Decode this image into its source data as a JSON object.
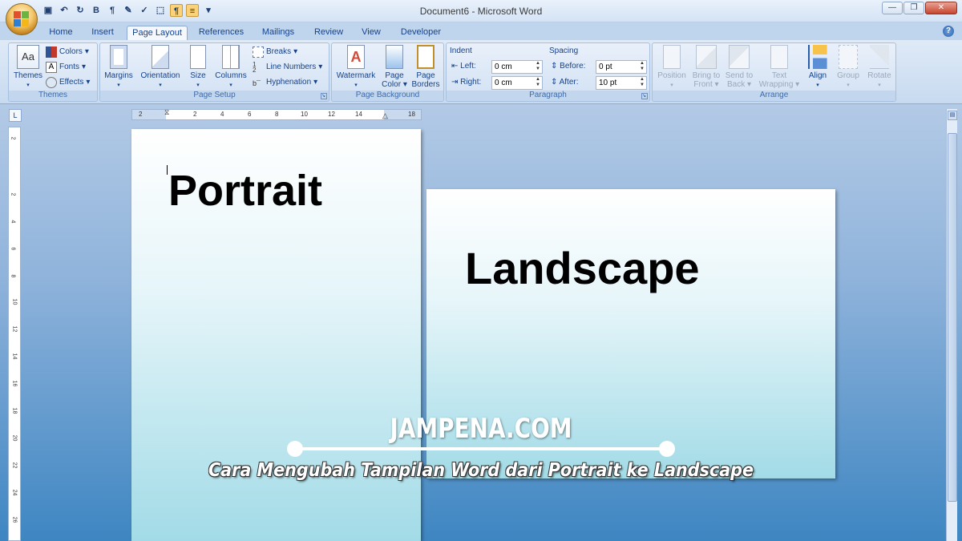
{
  "window": {
    "title": "Document6 - Microsoft Word"
  },
  "quick_access": [
    "save-icon",
    "undo-icon",
    "redo-icon",
    "bold-icon",
    "pilcrow-icon",
    "highlighter-icon",
    "spelling-icon",
    "selection-icon",
    "ltr-icon",
    "align-icon",
    "customize-icon"
  ],
  "tabs": [
    "Home",
    "Insert",
    "Page Layout",
    "References",
    "Mailings",
    "Review",
    "View",
    "Developer"
  ],
  "active_tab": "Page Layout",
  "ribbon": {
    "themes": {
      "label": "Themes",
      "themes_btn": "Themes",
      "colors": "Colors",
      "fonts": "Fonts",
      "effects": "Effects"
    },
    "page_setup": {
      "label": "Page Setup",
      "margins": "Margins",
      "orientation": "Orientation",
      "size": "Size",
      "columns": "Columns",
      "breaks": "Breaks",
      "line_numbers": "Line Numbers",
      "hyphenation": "Hyphenation"
    },
    "page_background": {
      "label": "Page Background",
      "watermark": "Watermark",
      "page_color_1": "Page",
      "page_color_2": "Color",
      "page_borders_1": "Page",
      "page_borders_2": "Borders"
    },
    "paragraph": {
      "label": "Paragraph",
      "indent": "Indent",
      "left_label": "Left:",
      "left_value": "0 cm",
      "right_label": "Right:",
      "right_value": "0 cm",
      "spacing": "Spacing",
      "before_label": "Before:",
      "before_value": "0 pt",
      "after_label": "After:",
      "after_value": "10 pt"
    },
    "arrange": {
      "label": "Arrange",
      "position": "Position",
      "bring_1": "Bring to",
      "bring_2": "Front",
      "send_1": "Send to",
      "send_2": "Back",
      "text_1": "Text",
      "text_2": "Wrapping",
      "align": "Align",
      "group": "Group",
      "rotate": "Rotate"
    }
  },
  "ruler": {
    "h_ticks": [
      "2",
      "2",
      "4",
      "6",
      "8",
      "10",
      "12",
      "14",
      "18"
    ],
    "v_ticks": [
      "2",
      "2",
      "4",
      "6",
      "8",
      "10",
      "12",
      "14",
      "16",
      "18",
      "20",
      "22",
      "24",
      "26"
    ],
    "tab_selector": "L"
  },
  "document": {
    "portrait_text": "Portrait",
    "landscape_text": "Landscape"
  },
  "overlay": {
    "brand": "JAMPENA.COM",
    "tagline": "Cara Mengubah Tampilan Word dari Portrait ke Landscape"
  },
  "colors": {
    "ribbon_text": "#15428b",
    "workspace_top": "#b3cae6",
    "workspace_bottom": "#3e86c2",
    "close_button": "#c6452d"
  }
}
